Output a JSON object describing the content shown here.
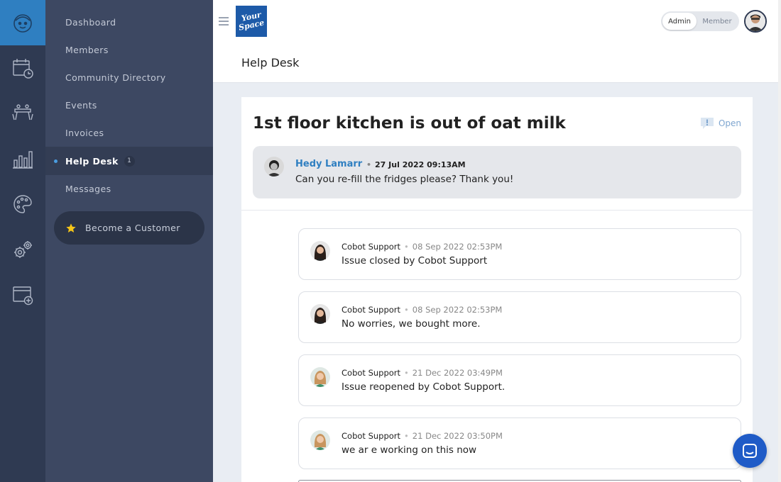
{
  "rail": {
    "icons": [
      "cobot-logo-icon",
      "calendar-icon",
      "meeting-room-icon",
      "analytics-icon",
      "palette-icon",
      "settings-gears-icon",
      "add-window-icon"
    ]
  },
  "nav": {
    "items": [
      {
        "label": "Dashboard"
      },
      {
        "label": "Members"
      },
      {
        "label": "Community Directory"
      },
      {
        "label": "Events"
      },
      {
        "label": "Invoices"
      },
      {
        "label": "Help Desk",
        "count": "1"
      },
      {
        "label": "Messages"
      }
    ],
    "become_customer": "Become a Customer"
  },
  "topbar": {
    "brand_line1": "Your",
    "brand_line2": "Space",
    "role_admin": "Admin",
    "role_member": "Member",
    "active_role": "Admin"
  },
  "page": {
    "title": "Help Desk"
  },
  "issue": {
    "title": "1st floor kitchen is out of oat milk",
    "status": "Open",
    "author": "Hedy Lamarr",
    "date": "27 Jul 2022 09:13AM",
    "text": "Can you re-fill the fridges please? Thank you!"
  },
  "replies": [
    {
      "author": "Cobot Support",
      "date": "08 Sep 2022 02:53PM",
      "text": "Issue closed by Cobot Support",
      "avatar": "dark-hair"
    },
    {
      "author": "Cobot Support",
      "date": "08 Sep 2022 02:53PM",
      "text": "No worries, we bought more.",
      "avatar": "dark-hair"
    },
    {
      "author": "Cobot Support",
      "date": "21 Dec 2022 03:49PM",
      "text": "Issue reopened by Cobot Support.",
      "avatar": "light-hair"
    },
    {
      "author": "Cobot Support",
      "date": "21 Dec 2022 03:50PM",
      "text": "we ar e working on this now",
      "avatar": "light-hair"
    }
  ],
  "colors": {
    "rail_bg": "#2f3a52",
    "nav_bg": "#3d4862",
    "accent_blue": "#2f7fc1",
    "chat_button": "#1f5bc7"
  }
}
